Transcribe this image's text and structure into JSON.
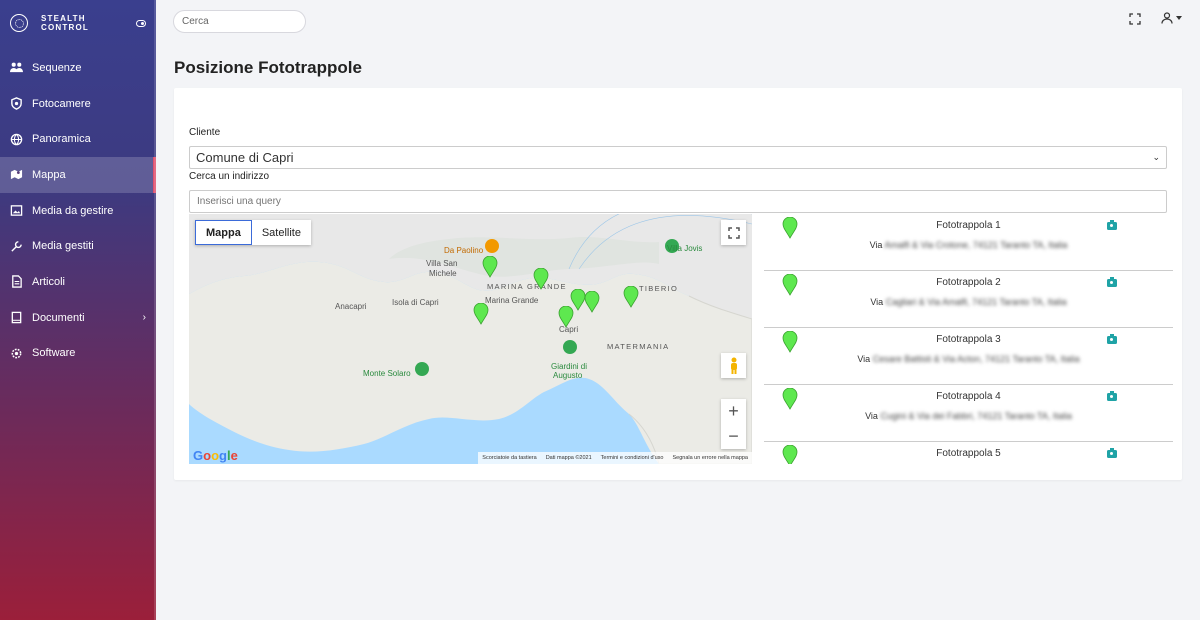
{
  "brand": {
    "name": "STEALTH CONTROL"
  },
  "sidebar": {
    "items": [
      {
        "label": "Sequenze",
        "icon": "group-icon",
        "active": false
      },
      {
        "label": "Fotocamere",
        "icon": "camera-shield-icon",
        "active": false
      },
      {
        "label": "Panoramica",
        "icon": "globe-icon",
        "active": false
      },
      {
        "label": "Mappa",
        "icon": "map-icon",
        "active": true
      },
      {
        "label": "Media da gestire",
        "icon": "image-icon",
        "active": false
      },
      {
        "label": "Media gestiti",
        "icon": "wrench-icon",
        "active": false
      },
      {
        "label": "Articoli",
        "icon": "document-icon",
        "active": false
      },
      {
        "label": "Documenti",
        "icon": "book-icon",
        "active": false,
        "has_submenu": true
      },
      {
        "label": "Software",
        "icon": "settings-icon",
        "active": false
      }
    ]
  },
  "topbar": {
    "search_placeholder": "Cerca"
  },
  "page": {
    "title": "Posizione Fototrappole"
  },
  "form": {
    "client_label": "Cliente",
    "client_value": "Comune di Capri",
    "address_label": "Cerca un indirizzo",
    "address_placeholder": "Inserisci una query"
  },
  "map": {
    "type_map": "Mappa",
    "type_satellite": "Satellite",
    "labels": {
      "villa_san_michele_1": "Villa San",
      "villa_san_michele_2": "Michele",
      "anacapri": "Anacapri",
      "isola": "Isola di Capri",
      "marina_grande_caps": "MARINA GRANDE",
      "marina_grande": "Marina Grande",
      "capri": "Capri",
      "tiberio": "TIBERIO",
      "matermania": "MATERMANIA",
      "villa_jovis": "Villa Jovis",
      "da_paolino": "Da Paolino",
      "giardini_1": "Giardini di",
      "giardini_2": "Augusto",
      "monte_solaro": "Monte Solaro"
    },
    "attribution": [
      "Scorciatoie da tastiera",
      "Dati mappa ©2021",
      "Termini e condizioni d'uso",
      "Segnala un errore nella mappa"
    ],
    "google": [
      "G",
      "o",
      "o",
      "g",
      "l",
      "e"
    ],
    "marker_color": "#5ee84f"
  },
  "traps": [
    {
      "name": "Fototrappola 1",
      "address_prefix": "Via",
      "address_blurred": "Amalfi & Via Crotone, 74121 Taranto TA, Italia"
    },
    {
      "name": "Fototrappola 2",
      "address_prefix": "Via",
      "address_blurred": "Cagliari & Via Amalfi, 74121 Taranto TA, Italia"
    },
    {
      "name": "Fototrappola 3",
      "address_prefix": "Via",
      "address_blurred": "Cesare Battisti & Via Acton, 74121 Taranto TA, Italia"
    },
    {
      "name": "Fototrappola 4",
      "address_prefix": "Via",
      "address_blurred": "Cugini & Via dei Fabbri, 74121 Taranto TA, Italia"
    },
    {
      "name": "Fototrappola 5",
      "address_prefix": "",
      "address_blurred": ""
    }
  ]
}
